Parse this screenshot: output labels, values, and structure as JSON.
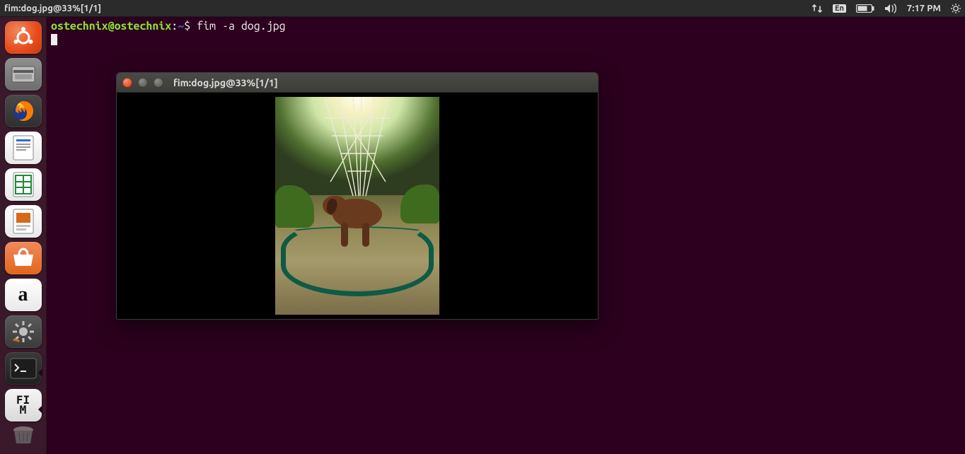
{
  "menubar": {
    "title": "fim:dog.jpg@33%[1/1]",
    "input_indicator": "En",
    "time": "7:17 PM"
  },
  "terminal": {
    "user_host": "ostechnix@ostechnix",
    "separator": ":",
    "path": "~",
    "prompt_suffix": "$ ",
    "command": "fim -a dog.jpg"
  },
  "fim_window": {
    "title": "fim:dog.jpg@33%[1/1]"
  },
  "launcher": {
    "items": [
      {
        "name": "dash"
      },
      {
        "name": "files"
      },
      {
        "name": "firefox"
      },
      {
        "name": "libreoffice-writer"
      },
      {
        "name": "libreoffice-calc"
      },
      {
        "name": "libreoffice-impress"
      },
      {
        "name": "ubuntu-software"
      },
      {
        "name": "amazon"
      },
      {
        "name": "settings"
      },
      {
        "name": "terminal"
      },
      {
        "name": "fim"
      }
    ],
    "amazon_glyph": "a",
    "fim_glyph": "FI\nM"
  }
}
